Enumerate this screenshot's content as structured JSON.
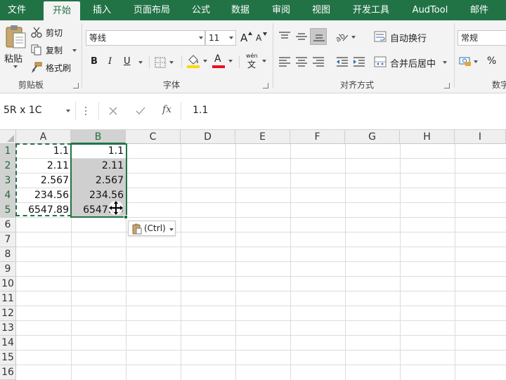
{
  "tabs": [
    "文件",
    "开始",
    "插入",
    "页面布局",
    "公式",
    "数据",
    "审阅",
    "视图",
    "开发工具",
    "AudTool",
    "邮件"
  ],
  "active_tab": "开始",
  "clipboard": {
    "paste": "粘贴",
    "cut": "剪切",
    "copy": "复制",
    "format_painter": "格式刷",
    "group": "剪贴板"
  },
  "font": {
    "name": "等线",
    "size": "11",
    "grow": "A",
    "shrink": "A",
    "bold": "B",
    "italic": "I",
    "underline": "U",
    "phonetic_top": "wén",
    "phonetic_bottom": "文",
    "color_letter": "A",
    "group": "字体"
  },
  "alignment": {
    "wrap": "自动换行",
    "merge": "合并后居中",
    "group": "对齐方式"
  },
  "number": {
    "format": "常规",
    "percent": "%",
    "group": "数字"
  },
  "formula_bar": {
    "name_box": "5R x 1C",
    "fx": "fx",
    "value": "1.1"
  },
  "columns": [
    "A",
    "B",
    "C",
    "D",
    "E",
    "F",
    "G",
    "H",
    "I"
  ],
  "rows": [
    "1",
    "2",
    "3",
    "4",
    "5",
    "6",
    "7",
    "8",
    "9",
    "10",
    "11",
    "12",
    "13",
    "14",
    "15",
    "16"
  ],
  "col_a": [
    "1.1",
    "2.11",
    "2.567",
    "234.56",
    "6547.89"
  ],
  "col_b": [
    "1.1",
    "2.11",
    "2.567",
    "234.56",
    "6547.89"
  ],
  "paste_options": "(Ctrl)",
  "colors": {
    "ribbon": "#217346",
    "font_color": "#e81123",
    "fill_color": "#ffd800",
    "selection_shade": "#cfcfcf"
  }
}
